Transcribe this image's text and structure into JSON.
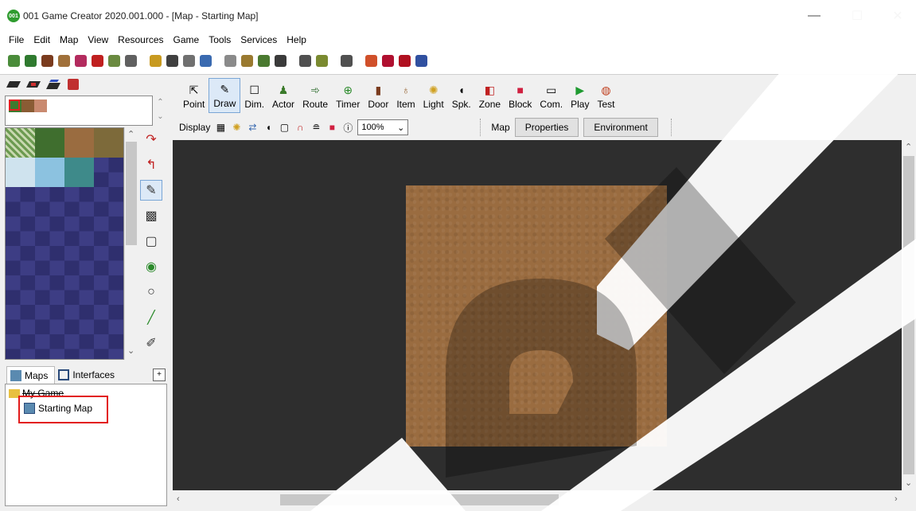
{
  "window": {
    "app_logo_text": "001",
    "title": "001 Game Creator 2020.001.000 - [Map - Starting Map]",
    "minimize_glyph": "—",
    "maximize_glyph": "☐",
    "close_glyph": "✕"
  },
  "menu": [
    "File",
    "Edit",
    "Map",
    "View",
    "Resources",
    "Game",
    "Tools",
    "Services",
    "Help"
  ],
  "toolbar": {
    "buttons": [
      {
        "label": "Point",
        "icon": "cursor-icon"
      },
      {
        "label": "Draw",
        "icon": "pencil-icon",
        "active": true
      },
      {
        "label": "Dim.",
        "icon": "square-icon"
      },
      {
        "label": "Actor",
        "icon": "actor-icon"
      },
      {
        "label": "Route",
        "icon": "route-icon"
      },
      {
        "label": "Timer",
        "icon": "timer-icon"
      },
      {
        "label": "Door",
        "icon": "door-icon"
      },
      {
        "label": "Item",
        "icon": "bag-icon"
      },
      {
        "label": "Light",
        "icon": "bulb-icon"
      },
      {
        "label": "Spk.",
        "icon": "speaker-icon"
      },
      {
        "label": "Zone",
        "icon": "zone-icon"
      },
      {
        "label": "Block",
        "icon": "block-icon"
      },
      {
        "label": "Com.",
        "icon": "comment-icon"
      },
      {
        "label": "Play",
        "icon": "play-icon"
      },
      {
        "label": "Test",
        "icon": "test-icon"
      }
    ]
  },
  "display_bar": {
    "label": "Display",
    "zoom": "100%",
    "map_label": "Map",
    "properties_button": "Properties",
    "environment_button": "Environment"
  },
  "left_panel": {
    "tabs": [
      {
        "label": "Maps",
        "active": true
      },
      {
        "label": "Interfaces",
        "active": false
      }
    ],
    "tree": {
      "root": "My Game",
      "child": "Starting Map"
    }
  },
  "colors": {
    "map_background": "#2e2e2e",
    "map_tile": "#9a6c40",
    "highlight": "#e21b1b",
    "tile_dark": "#2f2f6e",
    "tile_light": "#3d3d84"
  }
}
